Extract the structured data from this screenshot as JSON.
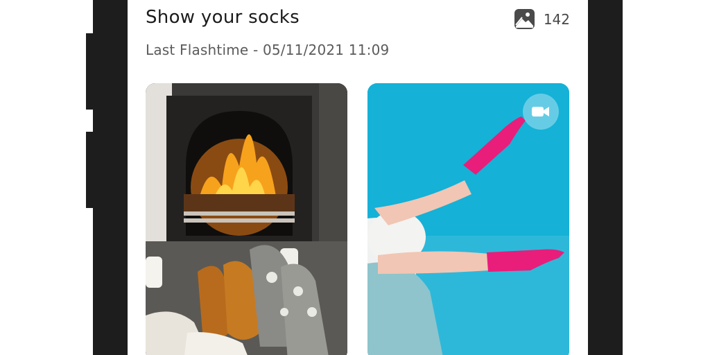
{
  "post": {
    "title": "Show your socks",
    "last_flash_label": "Last Flashtime - 05/11/2021 11:09",
    "media_count": "142",
    "media_count_icon": "gallery-icon"
  },
  "media": [
    {
      "type": "photo",
      "description": "fireplace-socks-photo"
    },
    {
      "type": "video",
      "badge_icon": "video-camera-icon"
    }
  ],
  "colors": {
    "frame": "#1d1d1d",
    "title": "#1b1b1b",
    "subtitle": "#5b5b5b",
    "sky": "#17b1d6",
    "socks_pink": "#e81e7a"
  }
}
